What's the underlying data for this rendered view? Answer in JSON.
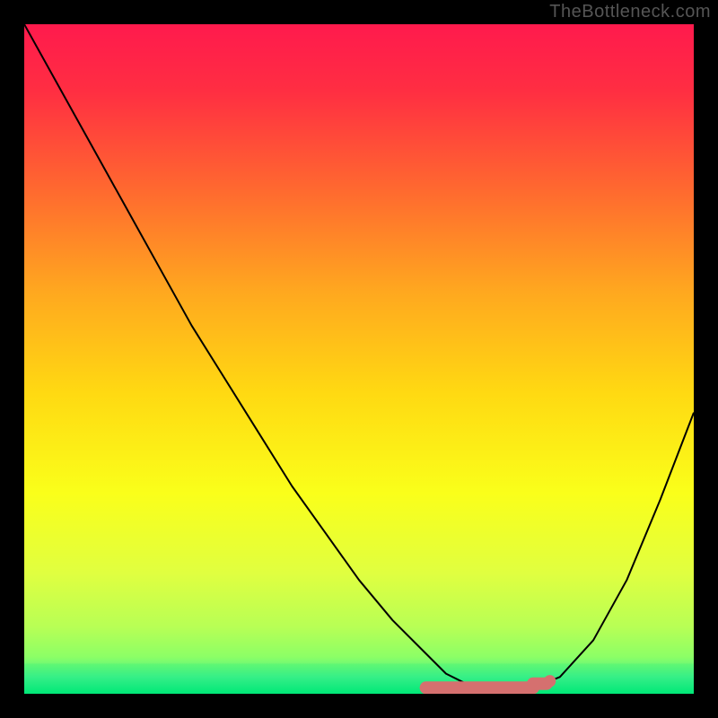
{
  "watermark": "TheBottleneck.com",
  "chart_data": {
    "type": "line",
    "title": "",
    "xlabel": "",
    "ylabel": "",
    "xlim": [
      0,
      100
    ],
    "ylim": [
      0,
      100
    ],
    "x": [
      0,
      5,
      10,
      15,
      20,
      25,
      30,
      35,
      40,
      45,
      50,
      55,
      60,
      63,
      66,
      70,
      73,
      76,
      80,
      85,
      90,
      95,
      100
    ],
    "values": [
      100,
      91,
      82,
      73,
      64,
      55,
      47,
      39,
      31,
      24,
      17,
      11,
      6,
      3,
      1.5,
      0.7,
      0.6,
      0.9,
      2.5,
      8,
      17,
      29,
      42
    ],
    "green_band_y": [
      0,
      4.5
    ],
    "curve_markers": [
      {
        "x_start": 60,
        "x_end": 76,
        "y_level": 0.9,
        "color": "#d5706f"
      },
      {
        "x_start": 76,
        "x_end": 78,
        "y_level": 1.5,
        "color": "#d5706f"
      }
    ],
    "gradient_stops": [
      {
        "offset": 0.0,
        "color": "#ff1a4d"
      },
      {
        "offset": 0.1,
        "color": "#ff2e42"
      },
      {
        "offset": 0.25,
        "color": "#ff6a2f"
      },
      {
        "offset": 0.4,
        "color": "#ffa81f"
      },
      {
        "offset": 0.55,
        "color": "#ffd912"
      },
      {
        "offset": 0.7,
        "color": "#faff1a"
      },
      {
        "offset": 0.82,
        "color": "#e0ff40"
      },
      {
        "offset": 0.9,
        "color": "#b8ff55"
      },
      {
        "offset": 0.945,
        "color": "#8cff66"
      },
      {
        "offset": 0.975,
        "color": "#40f08a"
      },
      {
        "offset": 1.0,
        "color": "#00e878"
      }
    ]
  }
}
